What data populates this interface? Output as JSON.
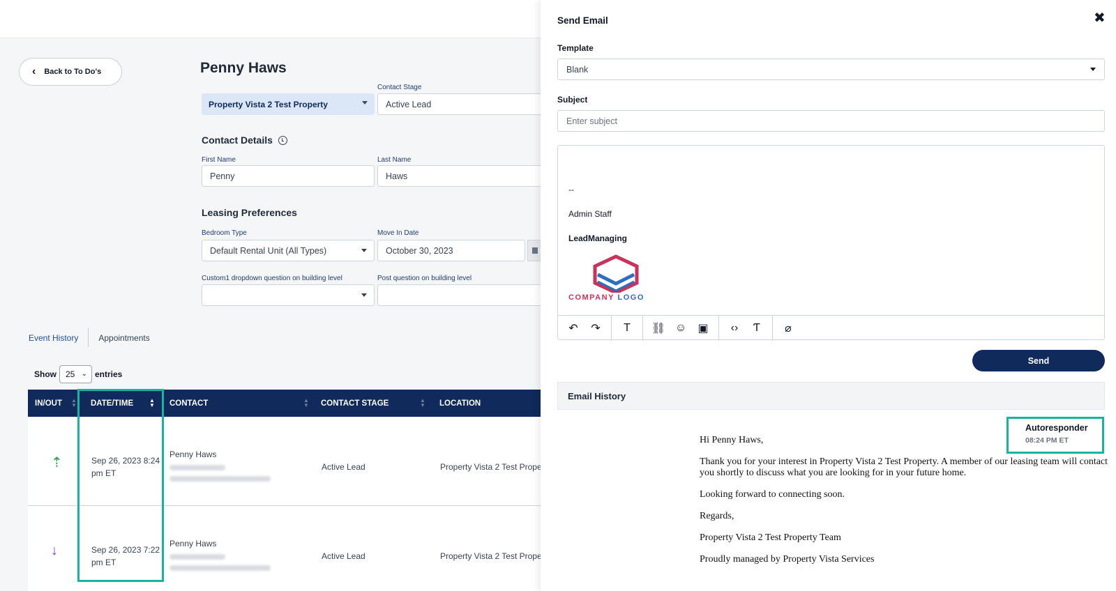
{
  "left": {
    "back_button": "Back to To Do's",
    "page_title": "Penny Haws",
    "property_select": "Property Vista 2 Test Property",
    "contact_stage": {
      "label": "Contact Stage",
      "value": "Active Lead"
    },
    "contact_details": {
      "title": "Contact Details",
      "first_name": {
        "label": "First Name",
        "value": "Penny"
      },
      "last_name": {
        "label": "Last Name",
        "value": "Haws"
      }
    },
    "leasing": {
      "title": "Leasing Preferences",
      "bedroom_type": {
        "label": "Bedroom Type",
        "value": "Default Rental Unit (All Types)"
      },
      "move_in": {
        "label": "Move In Date",
        "value": "October 30, 2023"
      },
      "custom1": {
        "label": "Custom1 dropdown question on building level",
        "value": ""
      },
      "post_question": {
        "label": "Post question on building level",
        "value": ""
      }
    },
    "tabs": [
      "Event History",
      "Appointments"
    ],
    "show": {
      "prefix": "Show",
      "value": "25",
      "suffix": "entries"
    },
    "columns": [
      "IN/OUT",
      "DATE/TIME",
      "CONTACT",
      "CONTACT STAGE",
      "LOCATION"
    ],
    "rows": [
      {
        "direction": "in",
        "date_line1": "Sep 26, 2023 8:24",
        "date_line2": "pm ET",
        "contact": "Penny Haws",
        "stage": "Active Lead",
        "location": "Property Vista 2 Test Prope"
      },
      {
        "direction": "out",
        "date_line1": "Sep 26, 2023 7:22",
        "date_line2": "pm ET",
        "contact": "Penny Haws",
        "stage": "Active Lead",
        "location": "Property Vista 2 Test Prope"
      }
    ]
  },
  "panel": {
    "title": "Send Email",
    "template": {
      "label": "Template",
      "value": "Blank"
    },
    "subject": {
      "label": "Subject",
      "placeholder": "Enter subject"
    },
    "signature": {
      "dashes": "--",
      "name": "Admin Staff",
      "company": "LeadManaging",
      "logo_text_1": "COMPANY",
      "logo_text_2": "LOGO"
    },
    "send_label": "Send",
    "history_title": "Email History",
    "autoresponder": {
      "label": "Autoresponder",
      "time": "08:24 PM ET"
    },
    "email_lines": [
      "Hi Penny Haws,",
      "Thank you for your interest in Property Vista 2 Test Property. A member of our leasing team will contact you shortly to discuss what you are looking for in your future home.",
      "Looking forward to connecting soon.",
      "Regards,",
      "Property Vista 2 Test Property Team",
      "Proudly managed by Property Vista Services"
    ]
  },
  "colors": {
    "navy": "#0f2a5b",
    "highlight": "#16b5a0"
  }
}
